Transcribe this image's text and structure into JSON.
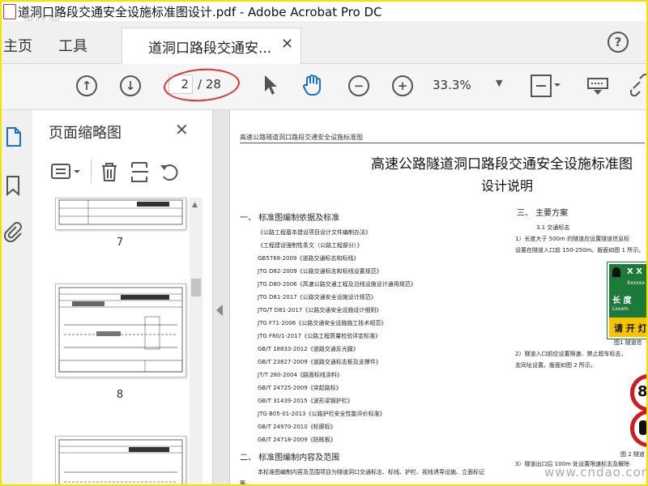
{
  "window": {
    "title": "道洞口路段交通安全设施标准图设计.pdf - Adobe Acrobat Pro DC",
    "watermark_top": "道标网",
    "watermark_bottom": "www.cndao.com"
  },
  "tabs": {
    "home": "主页",
    "tools": "工具",
    "document": "道洞口路段交通安..."
  },
  "toolbar": {
    "page_current": "2",
    "page_total": "/ 28",
    "zoom": "33.3%"
  },
  "panel": {
    "title": "页面缩略图",
    "thumbnails": [
      {
        "label": "7"
      },
      {
        "label": "8"
      }
    ]
  },
  "page": {
    "header": "高速公路隧道洞口路段交通安全设施标准图",
    "title_line1": "高速公路隧道洞口路段交通安全设施标准图",
    "title_line2": "设计说明",
    "section1": "一、 标准图编制依据及标准",
    "section2": "二、 标准图编制内容及范围",
    "section3": "三、 主要方案",
    "refs": [
      "《公路工程基本建设项目设计文件编制办法》",
      "《工程建设强制性条文（公路工程部分）》",
      "GB5768-2009《道路交通标志和标线》",
      "JTG D82-2009《公路交通标志和标线设置规范》",
      "JTG D80-2006《高速公路交通工程及沿线设施设计通用规范》",
      "JTG D81-2017《公路交通安全设施设计规范》",
      "JTG/T D81-2017《公路交通安全设施设计细则》",
      "JTG F71-2006《公路交通安全设施施工技术规范》",
      "JTG F80/1-2017《公路工程质量检验评定标准》",
      "GB/T 18833-2012《道路交通反光膜》",
      "GB/T 23827-2009《道路交通标志板及支撑件》",
      "JT/T 280-2004《路面标线涂料》",
      "GB/T 24725-2009《突起路标》",
      "GB/T 31439-2015《波形梁钢护栏》",
      "JTG B05-01-2013《公路护栏安全性能评价标准》",
      "GB/T 24970-2010《轮廓标》",
      "GB/T 24718-2009《防眩板》"
    ],
    "sec2_body": "本标准图编制内容及范围项目为隧道洞口交通标志、标线、护栏、视线诱导设施、立面标记",
    "sec2_body2": "等。",
    "sec3_sub": "3.1 交通标志",
    "sec3_p1a": "1）长度大于 500m 的隧道应设置隧道信息标",
    "sec3_p1b": "设置在隧道入口前 150-250m。版面如图 1 所示。",
    "sec3_p2a": "2）隧道入口前应设置限速、禁止超车标志，",
    "sec3_p2b": "志同址设置。版面如图 2 所示。",
    "sec3_p3": "3）隧道出口后 100m 处设置限速标志及解除",
    "fig1": "图1 隧道信",
    "fig2": "图 2 隧道",
    "sign_line1": "X X",
    "sign_line2": "Xxxxxx",
    "sign_line3": "长 度",
    "sign_line4": "Lxxxm",
    "sign_line5": "请 开 灯",
    "speed": "80"
  },
  "colors": {
    "frame": "#f2e300",
    "annotation": "#e53030",
    "sign_green": "#1e7a3a",
    "sign_yellow": "#f5c400"
  }
}
